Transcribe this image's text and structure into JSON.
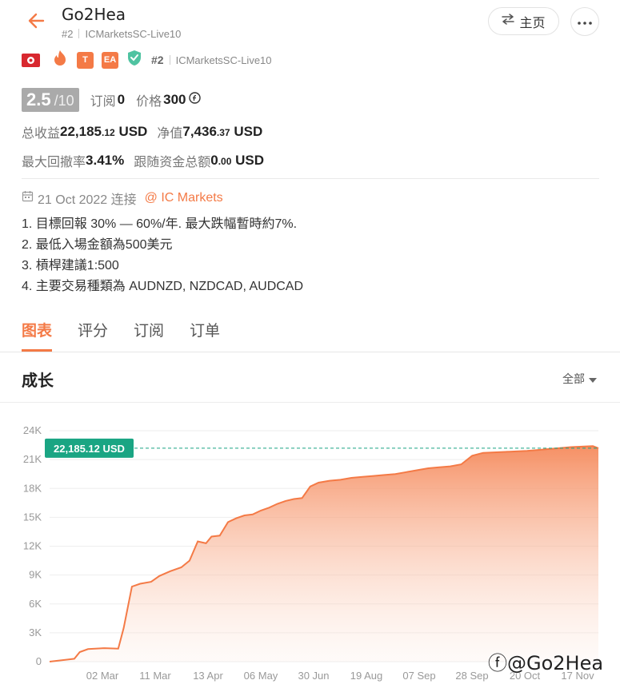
{
  "header": {
    "title": "Go2Hea",
    "rank": "#2",
    "server": "ICMarketsSC-Live10",
    "home_label": "主页"
  },
  "badges": {
    "flag": "hong-kong-flag",
    "pk": "PK",
    "t": "T",
    "ea": "EA",
    "rank": "#2",
    "server": "ICMarketsSC-Live10"
  },
  "stats": {
    "score": "2.5",
    "score_max": "/10",
    "subscribe_label": "订阅",
    "subscribe_value": "0",
    "price_label": "价格",
    "price_value": "300",
    "total_profit_label": "总收益",
    "total_profit_int": "22,185",
    "total_profit_dec": ".12",
    "total_profit_unit": "USD",
    "equity_label": "净值",
    "equity_int": "7,436",
    "equity_dec": ".37",
    "equity_unit": "USD",
    "max_drawdown_label": "最大回撤率",
    "max_drawdown_value": "3.41%",
    "follow_funds_label": "跟随资金总额",
    "follow_funds_int": "0",
    "follow_funds_dec": ".00",
    "follow_funds_unit": "USD"
  },
  "connect": {
    "date": "21 Oct 2022 连接",
    "broker": "@ IC Markets"
  },
  "description": [
    "1. 目標回報 30% — 60%/年. 最大跌幅暫時約7%.",
    "2. 最低入場金額為500美元",
    "3. 槓桿建議1:500",
    "4. 主要交易種類為 AUDNZD, NZDCAD, AUDCAD"
  ],
  "tabs": [
    "图表",
    "评分",
    "订阅",
    "订单"
  ],
  "section": {
    "title": "成长",
    "range": "全部"
  },
  "colors": {
    "accent": "#f47a46",
    "line_label": "#1aa583"
  },
  "chart_data": {
    "type": "area",
    "current_label": "22,185.12 USD",
    "y_ticks": [
      "0",
      "3K",
      "6K",
      "9K",
      "12K",
      "15K",
      "18K",
      "21K",
      "24K"
    ],
    "ylim": [
      0,
      24000
    ],
    "x_ticks": [
      "02 Mar",
      "11 Mar",
      "13 Apr",
      "06 May",
      "30 Jun",
      "19 Aug",
      "07 Sep",
      "28 Sep",
      "20 Oct",
      "17 Nov"
    ],
    "grid": true,
    "series": [
      {
        "points": [
          [
            0,
            0
          ],
          [
            0.03,
            200
          ],
          [
            0.045,
            300
          ],
          [
            0.055,
            1000
          ],
          [
            0.07,
            1300
          ],
          [
            0.1,
            1400
          ],
          [
            0.125,
            1350
          ],
          [
            0.135,
            3500
          ],
          [
            0.15,
            7800
          ],
          [
            0.165,
            8100
          ],
          [
            0.185,
            8300
          ],
          [
            0.2,
            8900
          ],
          [
            0.22,
            9400
          ],
          [
            0.24,
            9800
          ],
          [
            0.255,
            10500
          ],
          [
            0.27,
            12500
          ],
          [
            0.285,
            12300
          ],
          [
            0.295,
            13000
          ],
          [
            0.31,
            13100
          ],
          [
            0.325,
            14500
          ],
          [
            0.34,
            14900
          ],
          [
            0.355,
            15200
          ],
          [
            0.37,
            15300
          ],
          [
            0.385,
            15700
          ],
          [
            0.4,
            16000
          ],
          [
            0.415,
            16400
          ],
          [
            0.43,
            16700
          ],
          [
            0.445,
            16900
          ],
          [
            0.46,
            17000
          ],
          [
            0.475,
            18200
          ],
          [
            0.49,
            18600
          ],
          [
            0.51,
            18800
          ],
          [
            0.53,
            18900
          ],
          [
            0.55,
            19100
          ],
          [
            0.57,
            19200
          ],
          [
            0.59,
            19300
          ],
          [
            0.61,
            19400
          ],
          [
            0.63,
            19500
          ],
          [
            0.65,
            19700
          ],
          [
            0.67,
            19900
          ],
          [
            0.69,
            20100
          ],
          [
            0.71,
            20200
          ],
          [
            0.73,
            20300
          ],
          [
            0.75,
            20500
          ],
          [
            0.77,
            21400
          ],
          [
            0.79,
            21700
          ],
          [
            0.81,
            21750
          ],
          [
            0.83,
            21800
          ],
          [
            0.85,
            21850
          ],
          [
            0.87,
            21900
          ],
          [
            0.89,
            22000
          ],
          [
            0.91,
            22100
          ],
          [
            0.93,
            22200
          ],
          [
            0.95,
            22300
          ],
          [
            0.97,
            22350
          ],
          [
            0.99,
            22400
          ],
          [
            1.0,
            22185
          ]
        ]
      }
    ]
  }
}
